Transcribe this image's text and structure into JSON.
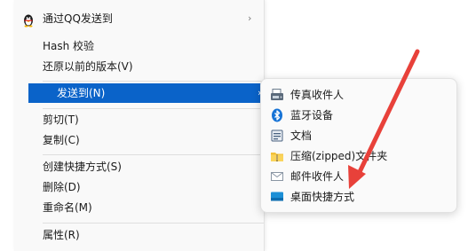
{
  "main_menu": {
    "items": [
      {
        "label": "通过QQ发送到",
        "chevron": "›"
      },
      {
        "label": "Hash 校验"
      },
      {
        "label": "还原以前的版本(V)"
      },
      {
        "label": "发送到(N)",
        "chevron": "›"
      },
      {
        "label": "剪切(T)"
      },
      {
        "label": "复制(C)"
      },
      {
        "label": "创建快捷方式(S)"
      },
      {
        "label": "删除(D)"
      },
      {
        "label": "重命名(M)"
      },
      {
        "label": "属性(R)"
      }
    ]
  },
  "sendto_submenu": {
    "items": [
      {
        "label": "传真收件人",
        "icon": "fax-icon"
      },
      {
        "label": "蓝牙设备",
        "icon": "bluetooth-icon"
      },
      {
        "label": "文档",
        "icon": "document-icon"
      },
      {
        "label": "压缩(zipped)文件夹",
        "icon": "zip-folder-icon"
      },
      {
        "label": "邮件收件人",
        "icon": "mail-icon"
      },
      {
        "label": "桌面快捷方式",
        "icon": "desktop-icon"
      }
    ]
  },
  "colors": {
    "selection": "#0a63c9",
    "arrow": "#e8413a"
  }
}
